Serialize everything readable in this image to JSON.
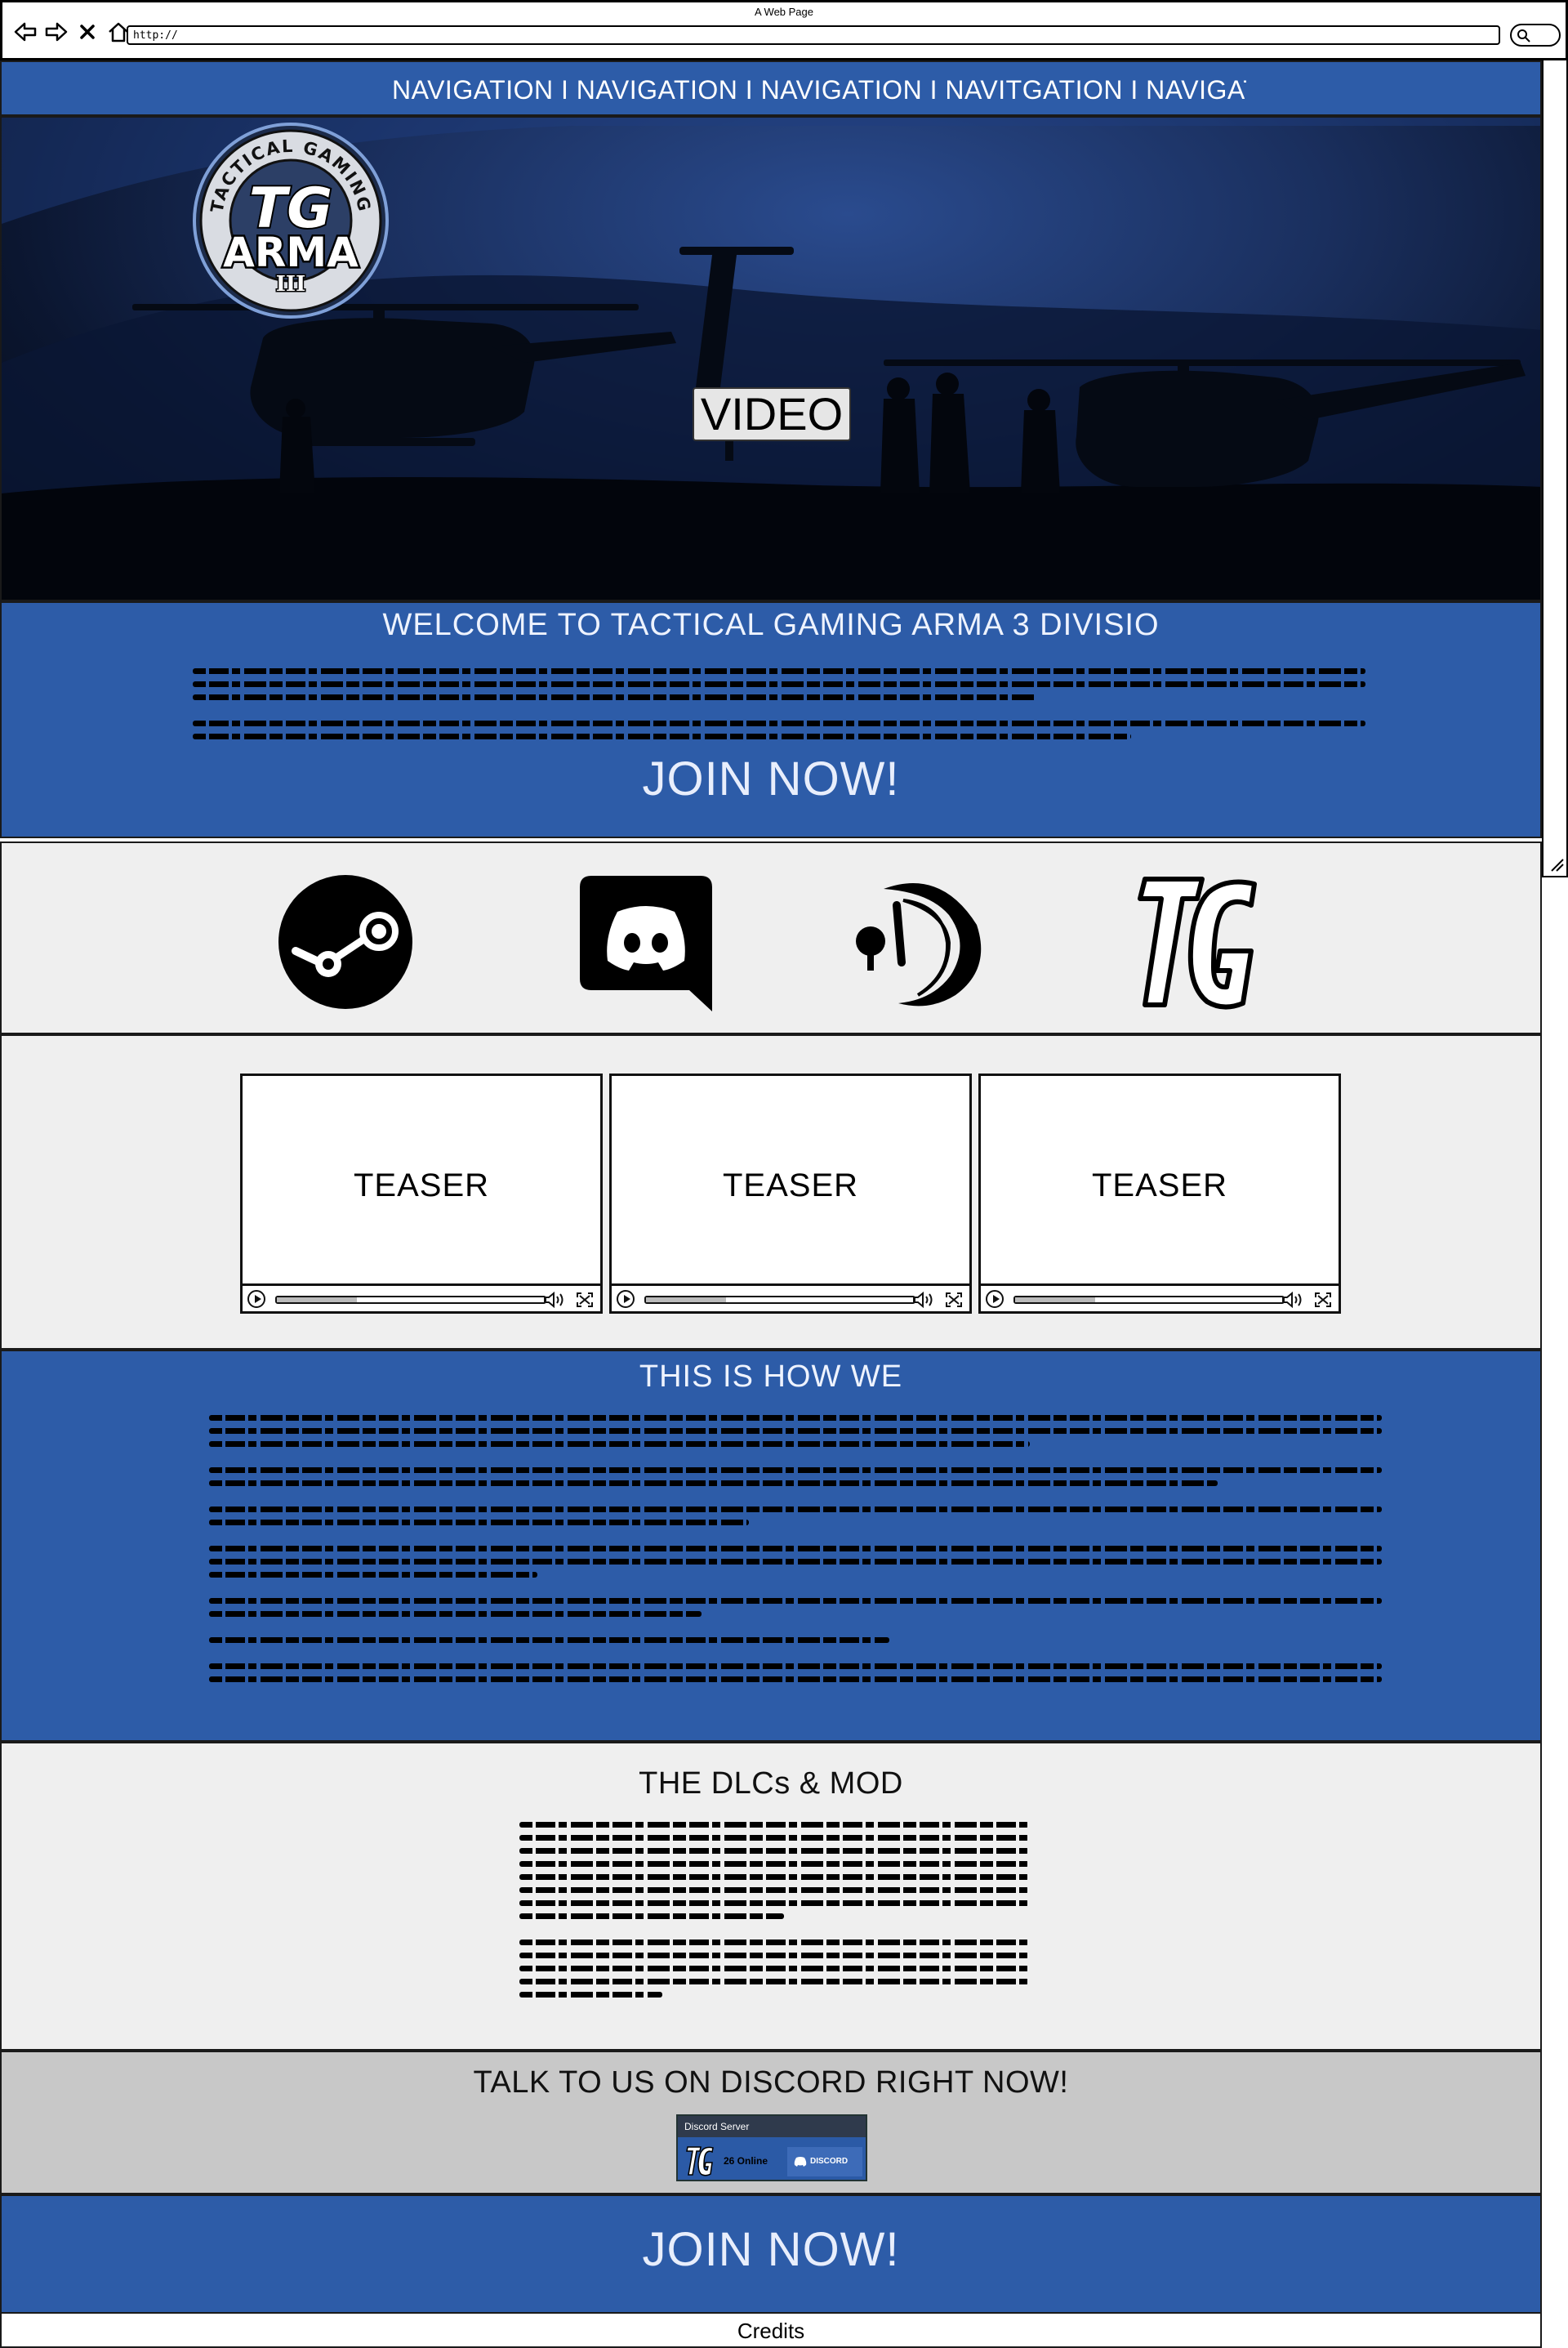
{
  "browser": {
    "window_title": "A Web Page",
    "url": "http://"
  },
  "nav": {
    "text": "NAVIGATION I NAVIGATION I NAVIGATION I NAVITGATION I NAVIGATIO"
  },
  "logo": {
    "ring_text": "TACTICAL GAMING",
    "tg": "TG",
    "arma": "ARMA",
    "roman": "III"
  },
  "hero": {
    "video_label": "VIDEO"
  },
  "welcome": {
    "title": "WELCOME TO TACTICAL GAMING ARMA 3 DIVISIO",
    "cta": "JOIN NOW!"
  },
  "social_icons": [
    {
      "name": "steam-icon"
    },
    {
      "name": "discord-icon"
    },
    {
      "name": "teamspeak-icon"
    },
    {
      "name": "tg-icon"
    }
  ],
  "teasers": [
    {
      "label": "TEASER"
    },
    {
      "label": "TEASER"
    },
    {
      "label": "TEASER"
    }
  ],
  "howwe": {
    "title": "THIS IS HOW WE"
  },
  "dlc": {
    "title": "THE DLCs & MOD"
  },
  "discord": {
    "title": "TALK TO US ON DISCORD RIGHT NOW!",
    "widget_header": "Discord Server",
    "online": "26 Online",
    "button": "DISCORD"
  },
  "join_footer": {
    "cta": "JOIN NOW!"
  },
  "footer": {
    "credits": "Credits"
  },
  "colors": {
    "brand_blue": "#2d5ca8",
    "light_gray": "#efefef",
    "mid_gray": "#c8c8c8"
  }
}
